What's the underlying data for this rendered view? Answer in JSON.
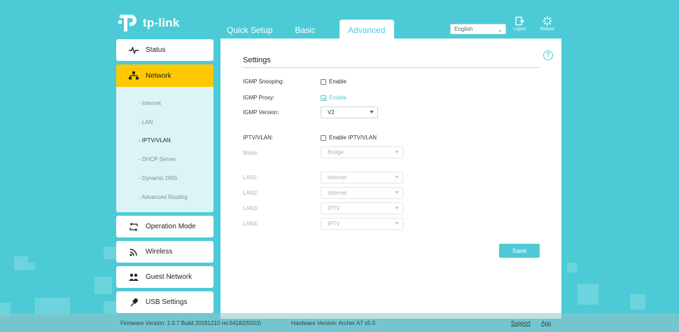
{
  "brand": {
    "logo_text": "tp-link"
  },
  "tabs": [
    {
      "label": "Quick Setup"
    },
    {
      "label": "Basic"
    },
    {
      "label": "Advanced"
    }
  ],
  "header": {
    "language": "English",
    "logout_label": "Logout",
    "reboot_label": "Reboot"
  },
  "sidebar": {
    "status": "Status",
    "network": "Network",
    "sub_items": [
      "Internet",
      "LAN",
      "IPTV/VLAN",
      "DHCP Server",
      "Dynamic DNS",
      "Advanced Routing"
    ],
    "operation_mode": "Operation Mode",
    "wireless": "Wireless",
    "guest_network": "Guest Network",
    "usb_settings": "USB Settings"
  },
  "settings": {
    "title": "Settings",
    "igmp_snooping_label": "IGMP Snooping:",
    "igmp_snooping_check": "Enable",
    "igmp_proxy_label": "IGMP Proxy:",
    "igmp_proxy_check": "Enable",
    "igmp_version_label": "IGMP Version:",
    "igmp_version_value": "V2",
    "iptv_label": "IPTV/VLAN:",
    "iptv_check": "Enable IPTV/VLAN",
    "mode_label": "Mode:",
    "mode_value": "Bridge",
    "lan1_label": "LAN1:",
    "lan1_value": "Internet",
    "lan2_label": "LAN2:",
    "lan2_value": "Internet",
    "lan3_label": "LAN3:",
    "lan3_value": "IPTV",
    "lan4_label": "LAN4:",
    "lan4_value": "IPTV",
    "save_label": "Save",
    "help_glyph": "?"
  },
  "footer": {
    "firmware": "Firmware Version: 1.0.7 Build 20181210 rel.54182(5553)",
    "hardware": "Hardware Version: Archer A7 v5.0",
    "support": "Support",
    "app": "App"
  },
  "colors": {
    "accent": "#4ccbd6",
    "active_menu": "#ffc800"
  }
}
